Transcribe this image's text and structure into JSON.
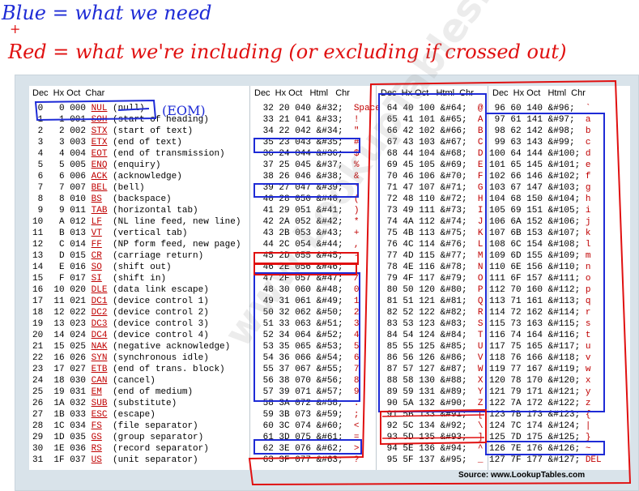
{
  "annotations": {
    "blue_note": "Blue = what we need",
    "plus": "+",
    "red_note": "Red = what we're including (or excluding if crossed out)",
    "eom": "(EOM)"
  },
  "header": {
    "col1": "Dec  Hx Oct  Char",
    "col2": "Dec  Hx Oct   Html   Chr",
    "col3": "Dec  Hx Oct   Html  Chr",
    "col4": "Dec  Hx Oct   Html  Chr"
  },
  "watermark": "www.LookupTables.com",
  "source": "Source:  www.LookupTables.com",
  "col1_rows": [
    [
      "0",
      "0",
      "000",
      "NUL",
      "(null)"
    ],
    [
      "1",
      "1",
      "001",
      "SOH",
      "(start of heading)"
    ],
    [
      "2",
      "2",
      "002",
      "STX",
      "(start of text)"
    ],
    [
      "3",
      "3",
      "003",
      "ETX",
      "(end of text)"
    ],
    [
      "4",
      "4",
      "004",
      "EOT",
      "(end of transmission)"
    ],
    [
      "5",
      "5",
      "005",
      "ENQ",
      "(enquiry)"
    ],
    [
      "6",
      "6",
      "006",
      "ACK",
      "(acknowledge)"
    ],
    [
      "7",
      "7",
      "007",
      "BEL",
      "(bell)"
    ],
    [
      "8",
      "8",
      "010",
      "BS",
      "(backspace)"
    ],
    [
      "9",
      "9",
      "011",
      "TAB",
      "(horizontal tab)"
    ],
    [
      "10",
      "A",
      "012",
      "LF",
      "(NL line feed, new line)"
    ],
    [
      "11",
      "B",
      "013",
      "VT",
      "(vertical tab)"
    ],
    [
      "12",
      "C",
      "014",
      "FF",
      "(NP form feed, new page)"
    ],
    [
      "13",
      "D",
      "015",
      "CR",
      "(carriage return)"
    ],
    [
      "14",
      "E",
      "016",
      "SO",
      "(shift out)"
    ],
    [
      "15",
      "F",
      "017",
      "SI",
      "(shift in)"
    ],
    [
      "16",
      "10",
      "020",
      "DLE",
      "(data link escape)"
    ],
    [
      "17",
      "11",
      "021",
      "DC1",
      "(device control 1)"
    ],
    [
      "18",
      "12",
      "022",
      "DC2",
      "(device control 2)"
    ],
    [
      "19",
      "13",
      "023",
      "DC3",
      "(device control 3)"
    ],
    [
      "20",
      "14",
      "024",
      "DC4",
      "(device control 4)"
    ],
    [
      "21",
      "15",
      "025",
      "NAK",
      "(negative acknowledge)"
    ],
    [
      "22",
      "16",
      "026",
      "SYN",
      "(synchronous idle)"
    ],
    [
      "23",
      "17",
      "027",
      "ETB",
      "(end of trans. block)"
    ],
    [
      "24",
      "18",
      "030",
      "CAN",
      "(cancel)"
    ],
    [
      "25",
      "19",
      "031",
      "EM",
      "(end of medium)"
    ],
    [
      "26",
      "1A",
      "032",
      "SUB",
      "(substitute)"
    ],
    [
      "27",
      "1B",
      "033",
      "ESC",
      "(escape)"
    ],
    [
      "28",
      "1C",
      "034",
      "FS",
      "(file separator)"
    ],
    [
      "29",
      "1D",
      "035",
      "GS",
      "(group separator)"
    ],
    [
      "30",
      "1E",
      "036",
      "RS",
      "(record separator)"
    ],
    [
      "31",
      "1F",
      "037",
      "US",
      "(unit separator)"
    ]
  ],
  "col2_rows": [
    [
      "32",
      "20",
      "040",
      "&#32;",
      "Space"
    ],
    [
      "33",
      "21",
      "041",
      "&#33;",
      "!"
    ],
    [
      "34",
      "22",
      "042",
      "&#34;",
      "\""
    ],
    [
      "35",
      "23",
      "043",
      "&#35;",
      "#"
    ],
    [
      "36",
      "24",
      "044",
      "&#36;",
      "$"
    ],
    [
      "37",
      "25",
      "045",
      "&#37;",
      "%"
    ],
    [
      "38",
      "26",
      "046",
      "&#38;",
      "&"
    ],
    [
      "39",
      "27",
      "047",
      "&#39;",
      "'"
    ],
    [
      "40",
      "28",
      "050",
      "&#40;",
      "("
    ],
    [
      "41",
      "29",
      "051",
      "&#41;",
      ")"
    ],
    [
      "42",
      "2A",
      "052",
      "&#42;",
      "*"
    ],
    [
      "43",
      "2B",
      "053",
      "&#43;",
      "+"
    ],
    [
      "44",
      "2C",
      "054",
      "&#44;",
      ","
    ],
    [
      "45",
      "2D",
      "055",
      "&#45;",
      "-"
    ],
    [
      "46",
      "2E",
      "056",
      "&#46;",
      "."
    ],
    [
      "47",
      "2F",
      "057",
      "&#47;",
      "/"
    ],
    [
      "48",
      "30",
      "060",
      "&#48;",
      "0"
    ],
    [
      "49",
      "31",
      "061",
      "&#49;",
      "1"
    ],
    [
      "50",
      "32",
      "062",
      "&#50;",
      "2"
    ],
    [
      "51",
      "33",
      "063",
      "&#51;",
      "3"
    ],
    [
      "52",
      "34",
      "064",
      "&#52;",
      "4"
    ],
    [
      "53",
      "35",
      "065",
      "&#53;",
      "5"
    ],
    [
      "54",
      "36",
      "066",
      "&#54;",
      "6"
    ],
    [
      "55",
      "37",
      "067",
      "&#55;",
      "7"
    ],
    [
      "56",
      "38",
      "070",
      "&#56;",
      "8"
    ],
    [
      "57",
      "39",
      "071",
      "&#57;",
      "9"
    ],
    [
      "58",
      "3A",
      "072",
      "&#58;",
      ":"
    ],
    [
      "59",
      "3B",
      "073",
      "&#59;",
      ";"
    ],
    [
      "60",
      "3C",
      "074",
      "&#60;",
      "<"
    ],
    [
      "61",
      "3D",
      "075",
      "&#61;",
      "="
    ],
    [
      "62",
      "3E",
      "076",
      "&#62;",
      ">"
    ],
    [
      "63",
      "3F",
      "077",
      "&#63;",
      "?"
    ]
  ],
  "col3_rows": [
    [
      "64",
      "40",
      "100",
      "&#64;",
      "@"
    ],
    [
      "65",
      "41",
      "101",
      "&#65;",
      "A"
    ],
    [
      "66",
      "42",
      "102",
      "&#66;",
      "B"
    ],
    [
      "67",
      "43",
      "103",
      "&#67;",
      "C"
    ],
    [
      "68",
      "44",
      "104",
      "&#68;",
      "D"
    ],
    [
      "69",
      "45",
      "105",
      "&#69;",
      "E"
    ],
    [
      "70",
      "46",
      "106",
      "&#70;",
      "F"
    ],
    [
      "71",
      "47",
      "107",
      "&#71;",
      "G"
    ],
    [
      "72",
      "48",
      "110",
      "&#72;",
      "H"
    ],
    [
      "73",
      "49",
      "111",
      "&#73;",
      "I"
    ],
    [
      "74",
      "4A",
      "112",
      "&#74;",
      "J"
    ],
    [
      "75",
      "4B",
      "113",
      "&#75;",
      "K"
    ],
    [
      "76",
      "4C",
      "114",
      "&#76;",
      "L"
    ],
    [
      "77",
      "4D",
      "115",
      "&#77;",
      "M"
    ],
    [
      "78",
      "4E",
      "116",
      "&#78;",
      "N"
    ],
    [
      "79",
      "4F",
      "117",
      "&#79;",
      "O"
    ],
    [
      "80",
      "50",
      "120",
      "&#80;",
      "P"
    ],
    [
      "81",
      "51",
      "121",
      "&#81;",
      "Q"
    ],
    [
      "82",
      "52",
      "122",
      "&#82;",
      "R"
    ],
    [
      "83",
      "53",
      "123",
      "&#83;",
      "S"
    ],
    [
      "84",
      "54",
      "124",
      "&#84;",
      "T"
    ],
    [
      "85",
      "55",
      "125",
      "&#85;",
      "U"
    ],
    [
      "86",
      "56",
      "126",
      "&#86;",
      "V"
    ],
    [
      "87",
      "57",
      "127",
      "&#87;",
      "W"
    ],
    [
      "88",
      "58",
      "130",
      "&#88;",
      "X"
    ],
    [
      "89",
      "59",
      "131",
      "&#89;",
      "Y"
    ],
    [
      "90",
      "5A",
      "132",
      "&#90;",
      "Z"
    ],
    [
      "91",
      "5B",
      "133",
      "&#91;",
      "["
    ],
    [
      "92",
      "5C",
      "134",
      "&#92;",
      "\\"
    ],
    [
      "93",
      "5D",
      "135",
      "&#93;",
      "]"
    ],
    [
      "94",
      "5E",
      "136",
      "&#94;",
      "^"
    ],
    [
      "95",
      "5F",
      "137",
      "&#95;",
      "_"
    ]
  ],
  "col4_rows": [
    [
      "96",
      "60",
      "140",
      "&#96;",
      "`"
    ],
    [
      "97",
      "61",
      "141",
      "&#97;",
      "a"
    ],
    [
      "98",
      "62",
      "142",
      "&#98;",
      "b"
    ],
    [
      "99",
      "63",
      "143",
      "&#99;",
      "c"
    ],
    [
      "100",
      "64",
      "144",
      "&#100;",
      "d"
    ],
    [
      "101",
      "65",
      "145",
      "&#101;",
      "e"
    ],
    [
      "102",
      "66",
      "146",
      "&#102;",
      "f"
    ],
    [
      "103",
      "67",
      "147",
      "&#103;",
      "g"
    ],
    [
      "104",
      "68",
      "150",
      "&#104;",
      "h"
    ],
    [
      "105",
      "69",
      "151",
      "&#105;",
      "i"
    ],
    [
      "106",
      "6A",
      "152",
      "&#106;",
      "j"
    ],
    [
      "107",
      "6B",
      "153",
      "&#107;",
      "k"
    ],
    [
      "108",
      "6C",
      "154",
      "&#108;",
      "l"
    ],
    [
      "109",
      "6D",
      "155",
      "&#109;",
      "m"
    ],
    [
      "110",
      "6E",
      "156",
      "&#110;",
      "n"
    ],
    [
      "111",
      "6F",
      "157",
      "&#111;",
      "o"
    ],
    [
      "112",
      "70",
      "160",
      "&#112;",
      "p"
    ],
    [
      "113",
      "71",
      "161",
      "&#113;",
      "q"
    ],
    [
      "114",
      "72",
      "162",
      "&#114;",
      "r"
    ],
    [
      "115",
      "73",
      "163",
      "&#115;",
      "s"
    ],
    [
      "116",
      "74",
      "164",
      "&#116;",
      "t"
    ],
    [
      "117",
      "75",
      "165",
      "&#117;",
      "u"
    ],
    [
      "118",
      "76",
      "166",
      "&#118;",
      "v"
    ],
    [
      "119",
      "77",
      "167",
      "&#119;",
      "w"
    ],
    [
      "120",
      "78",
      "170",
      "&#120;",
      "x"
    ],
    [
      "121",
      "79",
      "171",
      "&#121;",
      "y"
    ],
    [
      "122",
      "7A",
      "172",
      "&#122;",
      "z"
    ],
    [
      "123",
      "7B",
      "173",
      "&#123;",
      "{"
    ],
    [
      "124",
      "7C",
      "174",
      "&#124;",
      "|"
    ],
    [
      "125",
      "7D",
      "175",
      "&#125;",
      "}"
    ],
    [
      "126",
      "7E",
      "176",
      "&#126;",
      "~"
    ],
    [
      "127",
      "7F",
      "177",
      "&#127;",
      "DEL"
    ]
  ],
  "colors": {
    "blue_ink": "#1e2bd6",
    "red_ink": "#e01010",
    "char_red": "#c00000",
    "frame": "#d9e3ea"
  }
}
